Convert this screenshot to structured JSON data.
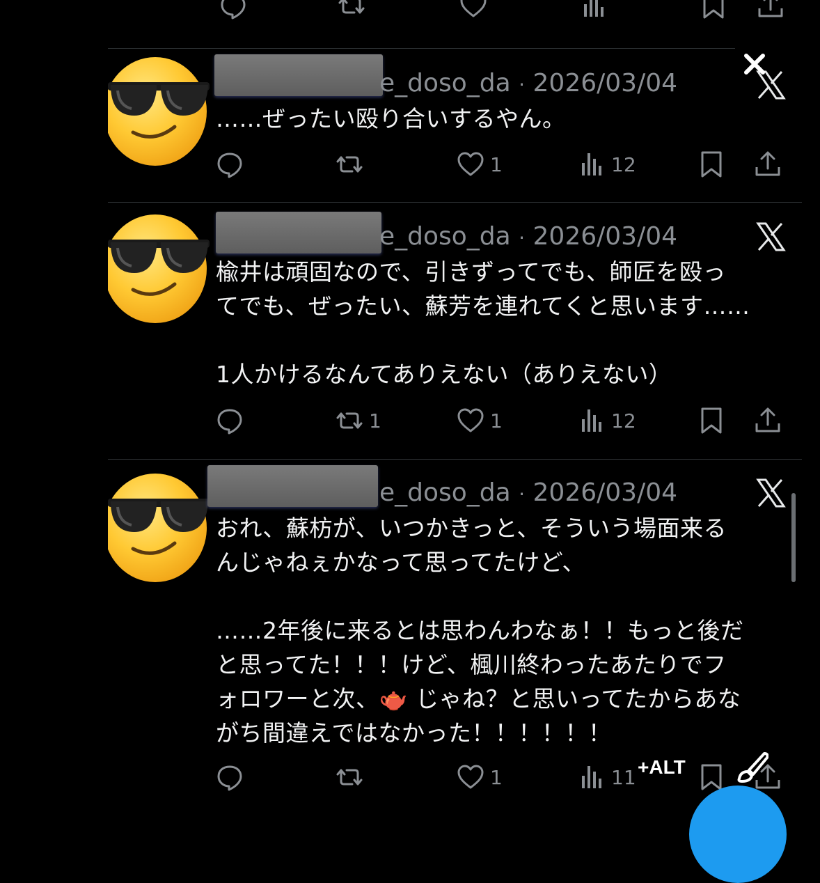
{
  "tweets": [
    {
      "handle": "e_doso_da",
      "separator": "·",
      "date": "2026/03/04",
      "text": "……ぜったい殴り合いするやん。",
      "replies": "",
      "retweets": "",
      "likes": "1",
      "views": "12"
    },
    {
      "handle": "e_doso_da",
      "separator": "·",
      "date": "2026/03/04",
      "text": "楡井は頑固なので、引きずってでも、師匠を殴っ\nてでも、ぜったい、蘇芳を連れてくと思います……\n\n1人かけるなんてありえない（ありえない）",
      "replies": "",
      "retweets": "1",
      "likes": "1",
      "views": "12"
    },
    {
      "handle": "e_doso_da",
      "separator": "·",
      "date": "2026/03/04",
      "text": "おれ、蘇枋が、いつかきっと、そういう場面来る\nんじゃねぇかなって思ってたけど、\n\n……2年後に来るとは思わんわなぁ！！もっと後だ\nと思ってた！！！けど、楓川終わったあたりでフ\nォロワーと次、🫖 じゃね？と思いってたからあな\nがち間違えではなかった！！！！！！",
      "replies": "",
      "retweets": "",
      "likes": "1",
      "views": "11"
    }
  ],
  "overlay": {
    "alt_label": "+ALT",
    "close_icon": "close-icon",
    "edit_icon": "brush-icon"
  },
  "colors": {
    "background": "#000000",
    "text": "#e7e9ea",
    "muted": "#8b8f94",
    "accent": "#1d9bf0"
  }
}
